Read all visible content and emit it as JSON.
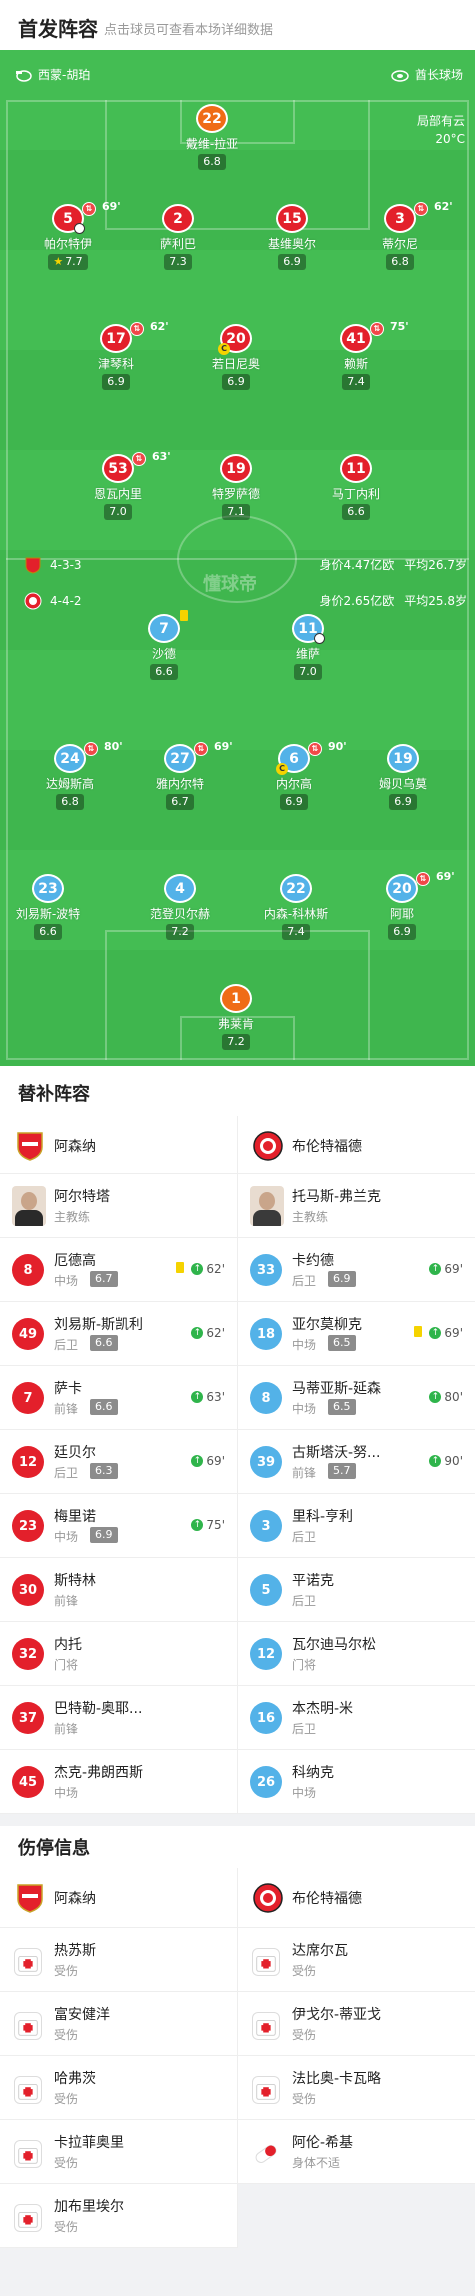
{
  "header": {
    "title": "首发阵容",
    "subtitle": "点击球员可查看本场详细数据"
  },
  "match_info": {
    "referee": "西蒙-胡珀",
    "stadium": "酋长球场",
    "weather": "局部有云",
    "temperature": "20°C"
  },
  "home": {
    "name": "阿森纳",
    "formation": "4-3-3",
    "value": "身价4.47亿欧",
    "age": "平均26.7岁",
    "coach": "阿尔特塔",
    "coach_role": "主教练",
    "players": [
      {
        "num": "22",
        "name": "戴维-拉亚",
        "rating": "6.8"
      },
      {
        "num": "5",
        "name": "帕尔特伊",
        "rating": "7.7",
        "sub": "69'",
        "star": "★"
      },
      {
        "num": "2",
        "name": "萨利巴",
        "rating": "7.3"
      },
      {
        "num": "15",
        "name": "基维奥尔",
        "rating": "6.9"
      },
      {
        "num": "3",
        "name": "蒂尔尼",
        "rating": "6.8",
        "sub": "62'"
      },
      {
        "num": "17",
        "name": "津琴科",
        "rating": "6.9",
        "sub": "62'"
      },
      {
        "num": "20",
        "name": "若日尼奥",
        "rating": "6.9"
      },
      {
        "num": "41",
        "name": "赖斯",
        "rating": "7.4",
        "sub": "75'"
      },
      {
        "num": "53",
        "name": "恩瓦内里",
        "rating": "7.0",
        "sub": "63'"
      },
      {
        "num": "19",
        "name": "特罗萨德",
        "rating": "7.1"
      },
      {
        "num": "11",
        "name": "马丁内利",
        "rating": "6.6"
      }
    ]
  },
  "away": {
    "name": "布伦特福德",
    "formation": "4-4-2",
    "value": "身价2.65亿欧",
    "age": "平均25.8岁",
    "coach": "托马斯-弗兰克",
    "coach_role": "主教练",
    "players": [
      {
        "num": "7",
        "name": "沙德",
        "rating": "6.6"
      },
      {
        "num": "11",
        "name": "维萨",
        "rating": "7.0"
      },
      {
        "num": "24",
        "name": "达姆斯高",
        "rating": "6.8",
        "sub": "80'"
      },
      {
        "num": "27",
        "name": "雅内尔特",
        "rating": "6.7",
        "sub": "69'"
      },
      {
        "num": "6",
        "name": "内尔高",
        "rating": "6.9",
        "sub": "90'"
      },
      {
        "num": "19",
        "name": "姆贝乌莫",
        "rating": "6.9"
      },
      {
        "num": "23",
        "name": "刘易斯-波特",
        "rating": "6.6"
      },
      {
        "num": "4",
        "name": "范登贝尔赫",
        "rating": "7.2"
      },
      {
        "num": "22",
        "name": "内森-科林斯",
        "rating": "7.4"
      },
      {
        "num": "20",
        "name": "阿耶",
        "rating": "6.9",
        "sub": "69'"
      },
      {
        "num": "1",
        "name": "弗莱肯",
        "rating": "7.2"
      }
    ]
  },
  "subs": {
    "title": "替补阵容",
    "home": [
      {
        "num": "8",
        "name": "厄德高",
        "pos": "中场",
        "rating": "6.7",
        "min": "62'"
      },
      {
        "num": "49",
        "name": "刘易斯-斯凯利",
        "pos": "后卫",
        "rating": "6.6",
        "min": "62'"
      },
      {
        "num": "7",
        "name": "萨卡",
        "pos": "前锋",
        "rating": "6.6",
        "min": "63'"
      },
      {
        "num": "12",
        "name": "廷贝尔",
        "pos": "后卫",
        "rating": "6.3",
        "min": "69'"
      },
      {
        "num": "23",
        "name": "梅里诺",
        "pos": "中场",
        "rating": "6.9",
        "min": "75'"
      },
      {
        "num": "30",
        "name": "斯特林",
        "pos": "前锋"
      },
      {
        "num": "32",
        "name": "内托",
        "pos": "门将"
      },
      {
        "num": "37",
        "name": "巴特勒-奥耶...",
        "pos": "前锋"
      },
      {
        "num": "45",
        "name": "杰克-弗朗西斯",
        "pos": "中场"
      }
    ],
    "away": [
      {
        "num": "33",
        "name": "卡约德",
        "pos": "后卫",
        "rating": "6.9",
        "min": "69'"
      },
      {
        "num": "18",
        "name": "亚尔莫柳克",
        "pos": "中场",
        "rating": "6.5",
        "min": "69'"
      },
      {
        "num": "8",
        "name": "马蒂亚斯-延森",
        "pos": "中场",
        "rating": "6.5",
        "min": "80'"
      },
      {
        "num": "39",
        "name": "古斯塔沃-努...",
        "pos": "前锋",
        "rating": "5.7",
        "min": "90'"
      },
      {
        "num": "3",
        "name": "里科-亨利",
        "pos": "后卫"
      },
      {
        "num": "5",
        "name": "平诺克",
        "pos": "后卫"
      },
      {
        "num": "12",
        "name": "瓦尔迪马尔松",
        "pos": "门将"
      },
      {
        "num": "16",
        "name": "本杰明-米",
        "pos": "后卫"
      },
      {
        "num": "26",
        "name": "科纳克",
        "pos": "中场"
      }
    ]
  },
  "injuries": {
    "title": "伤停信息",
    "home": [
      {
        "name": "热苏斯",
        "status": "受伤"
      },
      {
        "name": "富安健洋",
        "status": "受伤"
      },
      {
        "name": "哈弗茨",
        "status": "受伤"
      },
      {
        "name": "卡拉菲奥里",
        "status": "受伤"
      },
      {
        "name": "加布里埃尔",
        "status": "受伤"
      }
    ],
    "away": [
      {
        "name": "达席尔瓦",
        "status": "受伤"
      },
      {
        "name": "伊戈尔-蒂亚戈",
        "status": "受伤"
      },
      {
        "name": "法比奥-卡瓦略",
        "status": "受伤"
      },
      {
        "name": "阿伦-希基",
        "status": "身体不适"
      }
    ]
  },
  "watermark": "懂球帝",
  "colors": {
    "pitch": "#3fb64e",
    "home": "#e3202b",
    "away": "#53b2e8",
    "keeper": "#ef6c16"
  }
}
